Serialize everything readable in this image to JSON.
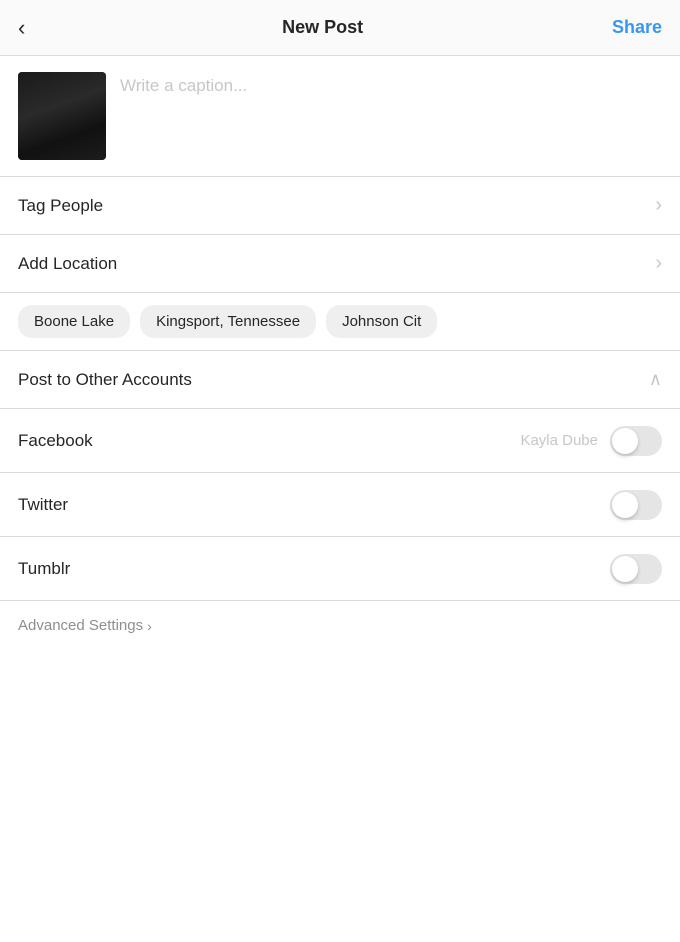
{
  "header": {
    "back_label": "<",
    "title": "New Post",
    "share_label": "Share"
  },
  "caption": {
    "placeholder": "Write a caption..."
  },
  "tag_people": {
    "label": "Tag People"
  },
  "add_location": {
    "label": "Add Location"
  },
  "location_chips": [
    {
      "label": "Boone Lake"
    },
    {
      "label": "Kingsport, Tennessee"
    },
    {
      "label": "Johnson Cit"
    }
  ],
  "post_to_other_accounts": {
    "label": "Post to Other Accounts"
  },
  "social_accounts": [
    {
      "label": "Facebook",
      "account_name": "Kayla Dube",
      "enabled": false
    },
    {
      "label": "Twitter",
      "account_name": "",
      "enabled": false
    },
    {
      "label": "Tumblr",
      "account_name": "",
      "enabled": false
    }
  ],
  "advanced_settings": {
    "label": "Advanced Settings"
  },
  "icons": {
    "chevron_right": "›",
    "chevron_up": "∧",
    "chevron_small": ">"
  }
}
